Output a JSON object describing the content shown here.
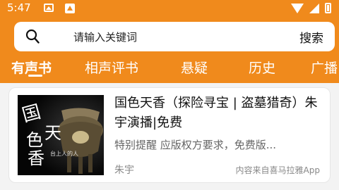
{
  "status_bar": {
    "time": "5:47",
    "icons": [
      "photo-icon",
      "warning-icon",
      "wifi-icon",
      "signal-icon",
      "battery-icon"
    ]
  },
  "search": {
    "placeholder": "请输入关键词",
    "button_label": "搜索"
  },
  "tabs": [
    {
      "label": "有声书",
      "active": true
    },
    {
      "label": "相声评书",
      "active": false
    },
    {
      "label": "悬疑",
      "active": false
    },
    {
      "label": "历史",
      "active": false
    },
    {
      "label": "广播",
      "active": false
    }
  ],
  "results": [
    {
      "title": "国色天香（探险寻宝 | 盗墓猎奇）朱宇演播|免费",
      "description": "特别提醒 应版权方要求，免费版...",
      "author": "朱宇",
      "source": "内容来自喜马拉雅App",
      "cover_text": [
        "国",
        "色",
        "天",
        "香"
      ],
      "cover_subtitle": "台上人的人"
    }
  ],
  "colors": {
    "header": "#f08a1c",
    "card_background": "#ffffff",
    "page_background": "#f3f3f3"
  }
}
